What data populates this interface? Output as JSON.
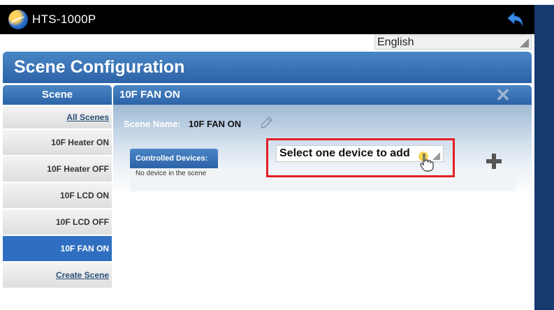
{
  "app": {
    "title": "HTS-1000P"
  },
  "language": {
    "selected": "English"
  },
  "page": {
    "title": "Scene Configuration"
  },
  "sidebar": {
    "header": "Scene",
    "items": [
      {
        "label": "All Scenes"
      },
      {
        "label": "10F Heater ON"
      },
      {
        "label": "10F Heater OFF"
      },
      {
        "label": "10F LCD ON"
      },
      {
        "label": "10F LCD OFF"
      },
      {
        "label": "10F FAN ON"
      },
      {
        "label": "Create Scene"
      }
    ]
  },
  "panel": {
    "title": "10F FAN ON",
    "scene_name_label": "Scene Name:",
    "scene_name_value": "10F FAN ON",
    "controlled_devices_label": "Controlled Devices:",
    "no_device_text": "No device in the scene",
    "device_select_placeholder": "Select one device to add"
  },
  "colors": {
    "accent": "#2f6fc1",
    "highlight": "#e31e24",
    "frame": "#173a6e"
  }
}
